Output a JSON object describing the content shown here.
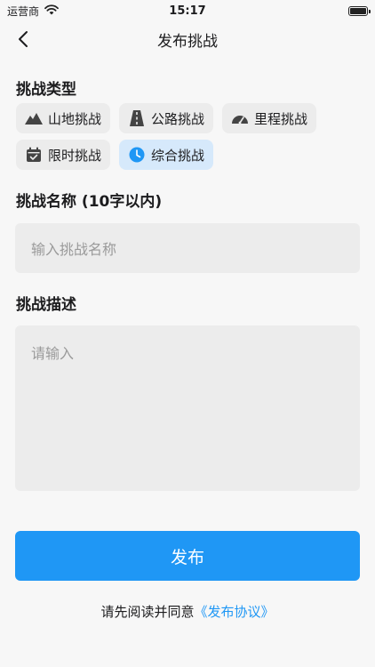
{
  "status_bar": {
    "carrier": "运营商",
    "time": "15:17"
  },
  "nav": {
    "title": "发布挑战"
  },
  "type_section": {
    "title": "挑战类型",
    "options": [
      {
        "label": "山地挑战",
        "icon": "mountain-icon"
      },
      {
        "label": "公路挑战",
        "icon": "road-icon"
      },
      {
        "label": "里程挑战",
        "icon": "speedometer-icon"
      },
      {
        "label": "限时挑战",
        "icon": "calendar-icon"
      },
      {
        "label": "综合挑战",
        "icon": "clock-icon",
        "selected": true
      }
    ]
  },
  "name_section": {
    "title": "挑战名称 (10字以内)",
    "placeholder": "输入挑战名称"
  },
  "desc_section": {
    "title": "挑战描述",
    "placeholder": "请输入"
  },
  "publish_button": {
    "label": "发布"
  },
  "agreement": {
    "prefix": "请先阅读并同意",
    "link": "《发布协议》"
  },
  "colors": {
    "accent": "#1f97f5",
    "chip_bg": "#ececec",
    "chip_selected_bg": "#d6e9fb"
  }
}
